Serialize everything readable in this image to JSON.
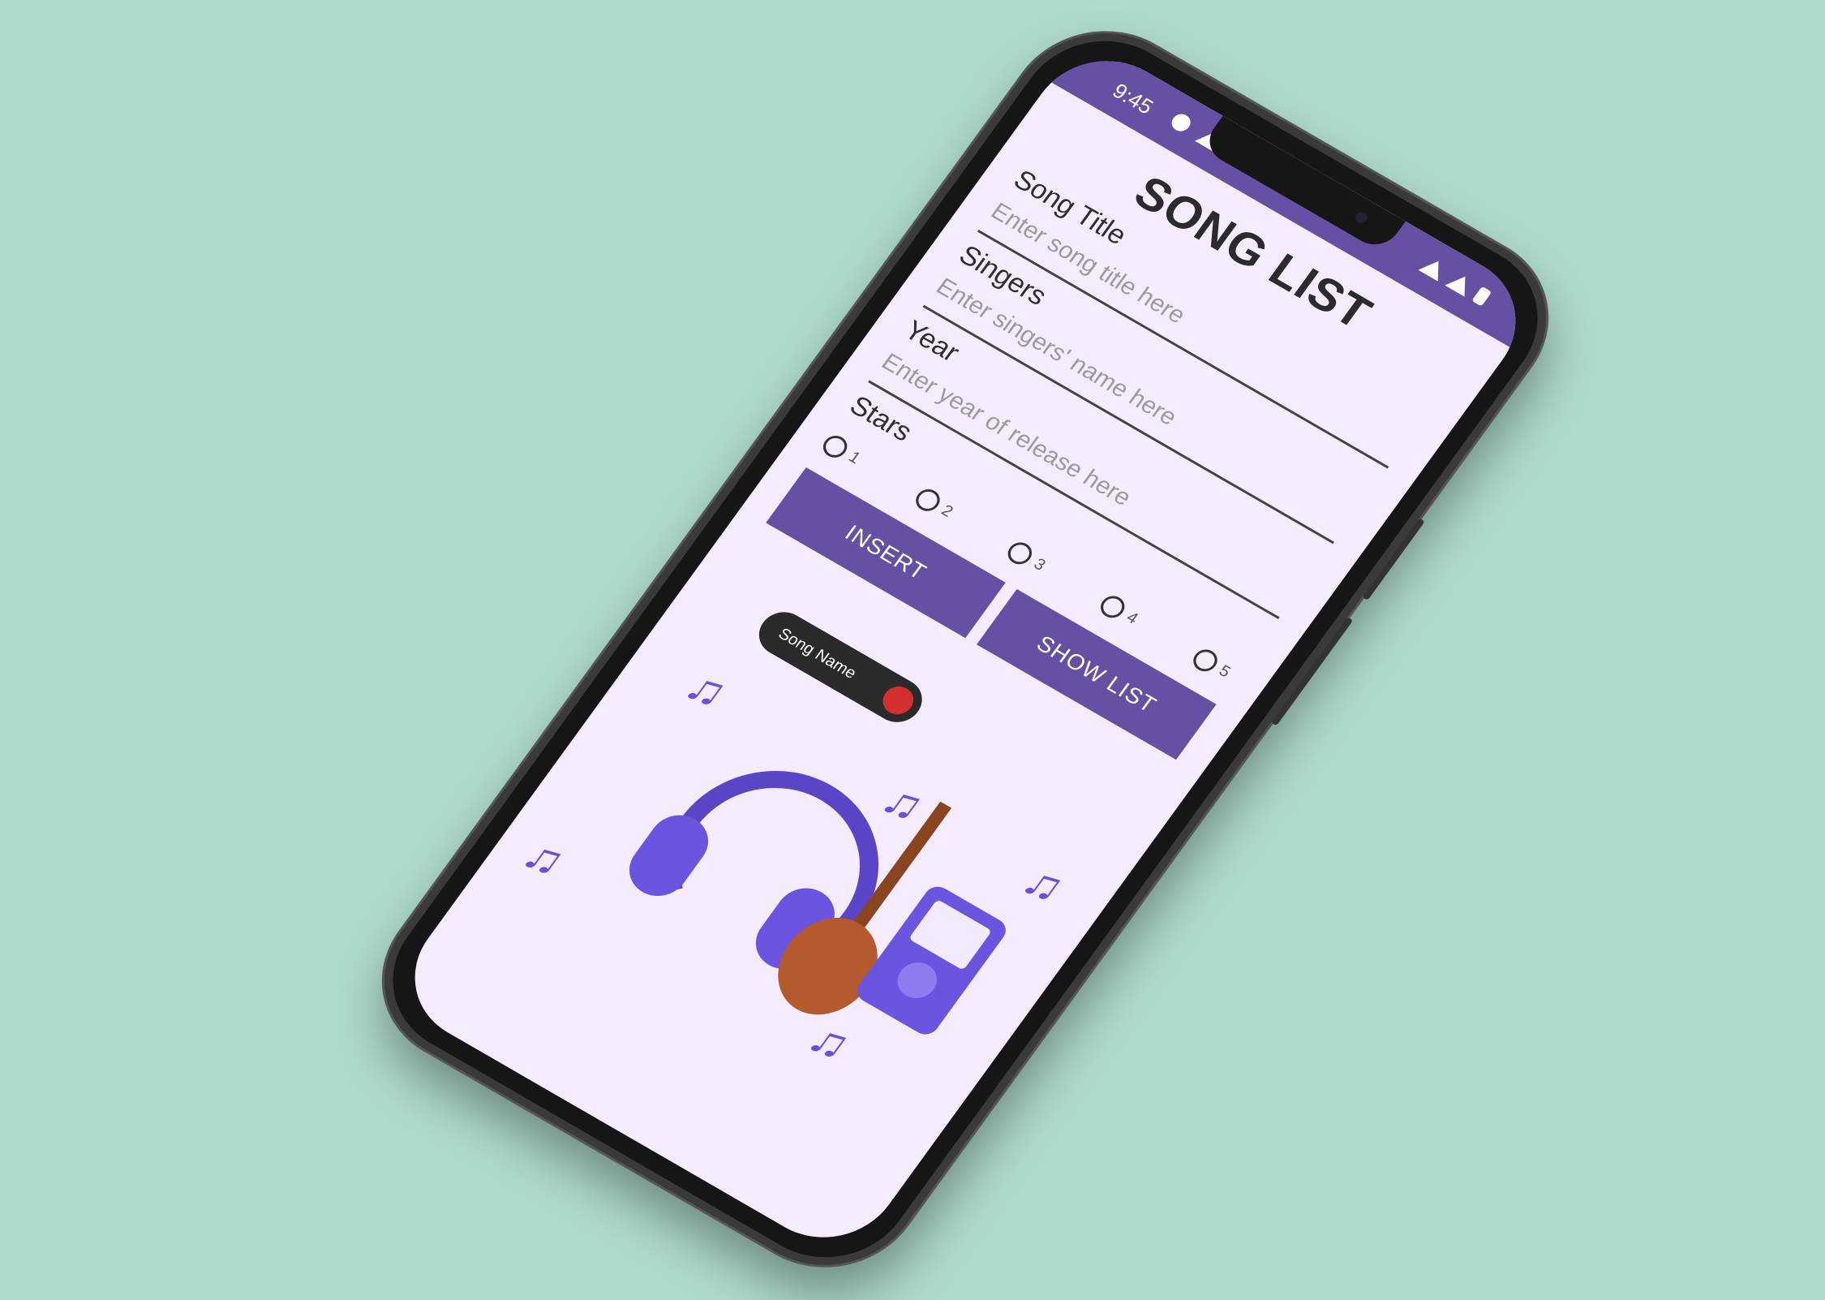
{
  "status_bar": {
    "time": "9:45"
  },
  "header": {
    "title": "SONG LIST"
  },
  "form": {
    "song_title": {
      "label": "Song Title",
      "placeholder": "Enter song title here"
    },
    "singers": {
      "label": "Singers",
      "placeholder": "Enter singers' name here"
    },
    "year": {
      "label": "Year",
      "placeholder": "Enter year of release here"
    },
    "stars": {
      "label": "Stars",
      "options": [
        "1",
        "2",
        "3",
        "4",
        "5"
      ]
    }
  },
  "buttons": {
    "insert": "INSERT",
    "show_list": "SHOW LIST"
  },
  "illustration": {
    "song_name": "Song Name"
  }
}
